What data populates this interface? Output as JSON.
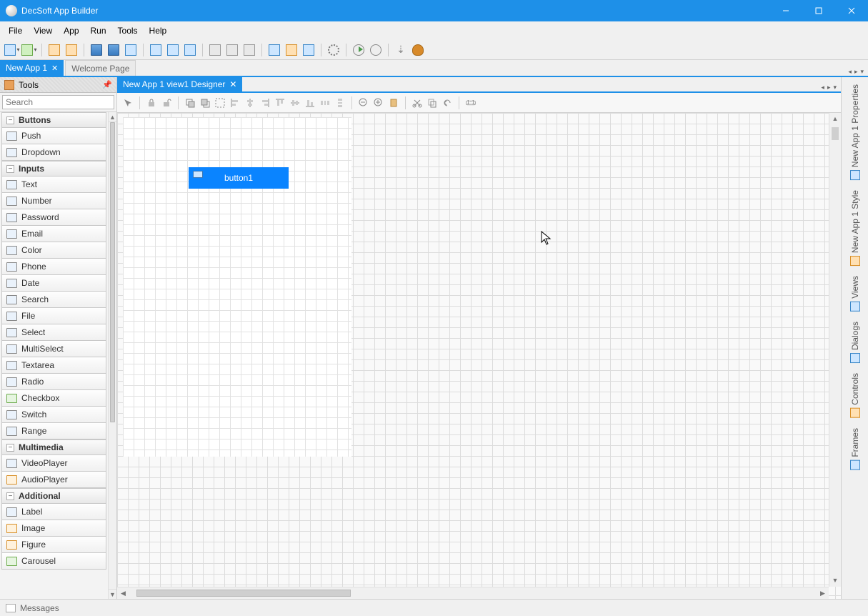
{
  "titlebar": {
    "title": "DecSoft App Builder"
  },
  "menubar": [
    "File",
    "View",
    "App",
    "Run",
    "Tools",
    "Help"
  ],
  "app_tabs": {
    "active": {
      "label": "New App 1",
      "closable": true
    },
    "inactive": {
      "label": "Welcome Page"
    }
  },
  "tools_panel": {
    "title": "Tools",
    "search_placeholder": "Search",
    "groups": [
      {
        "name": "Buttons",
        "items": [
          "Push",
          "Dropdown"
        ]
      },
      {
        "name": "Inputs",
        "items": [
          "Text",
          "Number",
          "Password",
          "Email",
          "Color",
          "Phone",
          "Date",
          "Search",
          "File",
          "Select",
          "MultiSelect",
          "Textarea",
          "Radio",
          "Checkbox",
          "Switch",
          "Range"
        ]
      },
      {
        "name": "Multimedia",
        "items": [
          "VideoPlayer",
          "AudioPlayer"
        ]
      },
      {
        "name": "Additional",
        "items": [
          "Label",
          "Image",
          "Figure",
          "Carousel"
        ]
      }
    ]
  },
  "designer": {
    "tab_label": "New App 1 view1 Designer",
    "placed_button": "button1"
  },
  "right_dock": [
    "New App 1 Properties",
    "New App 1 Style",
    "Views",
    "Dialogs",
    "Controls",
    "Frames"
  ],
  "statusbar": {
    "messages": "Messages"
  }
}
